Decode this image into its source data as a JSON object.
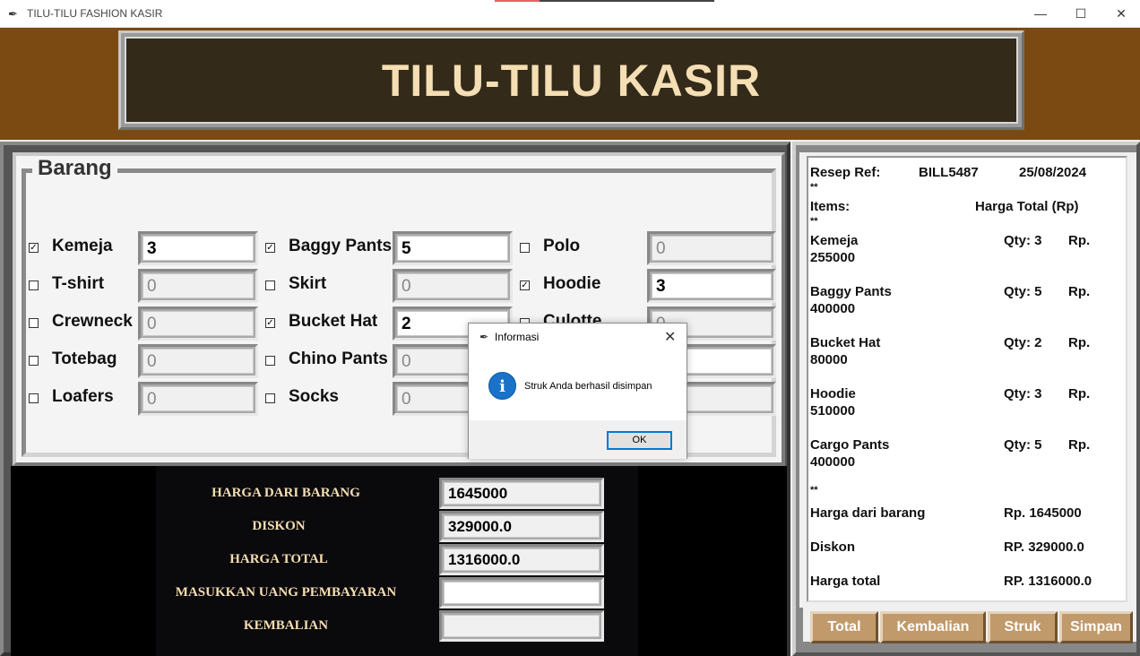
{
  "window": {
    "title": "TILU-TILU FASHION KASIR",
    "feather_icon": "feather-icon",
    "min_glyph": "—",
    "max_glyph": "☐",
    "close_glyph": "✕"
  },
  "header": {
    "title": "TILU-TILU KASIR"
  },
  "barang": {
    "label": "Barang",
    "items": [
      {
        "name": "Kemeja",
        "checked": true,
        "qty": "3"
      },
      {
        "name": "T-shirt",
        "checked": false,
        "qty": "0"
      },
      {
        "name": "Crewneck",
        "checked": false,
        "qty": "0"
      },
      {
        "name": "Totebag",
        "checked": false,
        "qty": "0"
      },
      {
        "name": "Loafers",
        "checked": false,
        "qty": "0"
      },
      {
        "name": "Baggy Pants",
        "checked": true,
        "qty": "5"
      },
      {
        "name": "Skirt",
        "checked": false,
        "qty": "0"
      },
      {
        "name": "Bucket Hat",
        "checked": true,
        "qty": "2"
      },
      {
        "name": "Chino Pants",
        "checked": false,
        "qty": "0"
      },
      {
        "name": "Socks",
        "checked": false,
        "qty": "0"
      },
      {
        "name": "Polo",
        "checked": false,
        "qty": "0"
      },
      {
        "name": "Hoodie",
        "checked": true,
        "qty": "3"
      },
      {
        "name": "Culotte",
        "checked": false,
        "qty": "0"
      }
    ]
  },
  "totals": {
    "harga_barang_label": "HARGA DARI BARANG",
    "harga_barang_value": "1645000",
    "diskon_label": "DISKON",
    "diskon_value": "329000.0",
    "harga_total_label": "HARGA TOTAL",
    "harga_total_value": "1316000.0",
    "uang_label": "MASUKKAN UANG PEMBAYARAN",
    "uang_value": "",
    "kembalian_label": "KEMBALIAN",
    "kembalian_value": ""
  },
  "receipt": {
    "ref_label": "Resep Ref:",
    "ref_value": "BILL5487",
    "date": "25/08/2024",
    "sep": "**",
    "items_label": "Items:",
    "harga_label": "Harga Total (Rp)",
    "lines": [
      {
        "name": "Kemeja",
        "qty": "Qty: 3",
        "rp": "Rp.",
        "total": "255000"
      },
      {
        "name": "Baggy Pants",
        "qty": "Qty: 5",
        "rp": "Rp.",
        "total": "400000"
      },
      {
        "name": "Bucket Hat",
        "qty": "Qty: 2",
        "rp": "Rp.",
        "total": "80000"
      },
      {
        "name": "Hoodie",
        "qty": "Qty: 3",
        "rp": "Rp.",
        "total": "510000"
      },
      {
        "name": "Cargo Pants",
        "qty": "Qty: 5",
        "rp": "Rp.",
        "total": "400000"
      }
    ],
    "harga_barang_label": "Harga dari barang",
    "harga_barang_value": "Rp. 1645000",
    "diskon_label": "Diskon",
    "diskon_value": "RP. 329000.0",
    "total_label": "Harga total",
    "total_value": "RP. 1316000.0"
  },
  "buttons": {
    "total": "Total",
    "kembalian": "Kembalian",
    "struk": "Struk",
    "simpan": "Simpan"
  },
  "dialog": {
    "title": "Informasi",
    "message": "Struk Anda berhasil disimpan",
    "ok": "OK",
    "info_glyph": "i",
    "close_glyph": "✕"
  },
  "colors": {
    "header_bg": "#7a4a12",
    "title_text": "#f5deb3",
    "button_bg": "#c19a6b",
    "dialog_accent": "#0078d7"
  }
}
